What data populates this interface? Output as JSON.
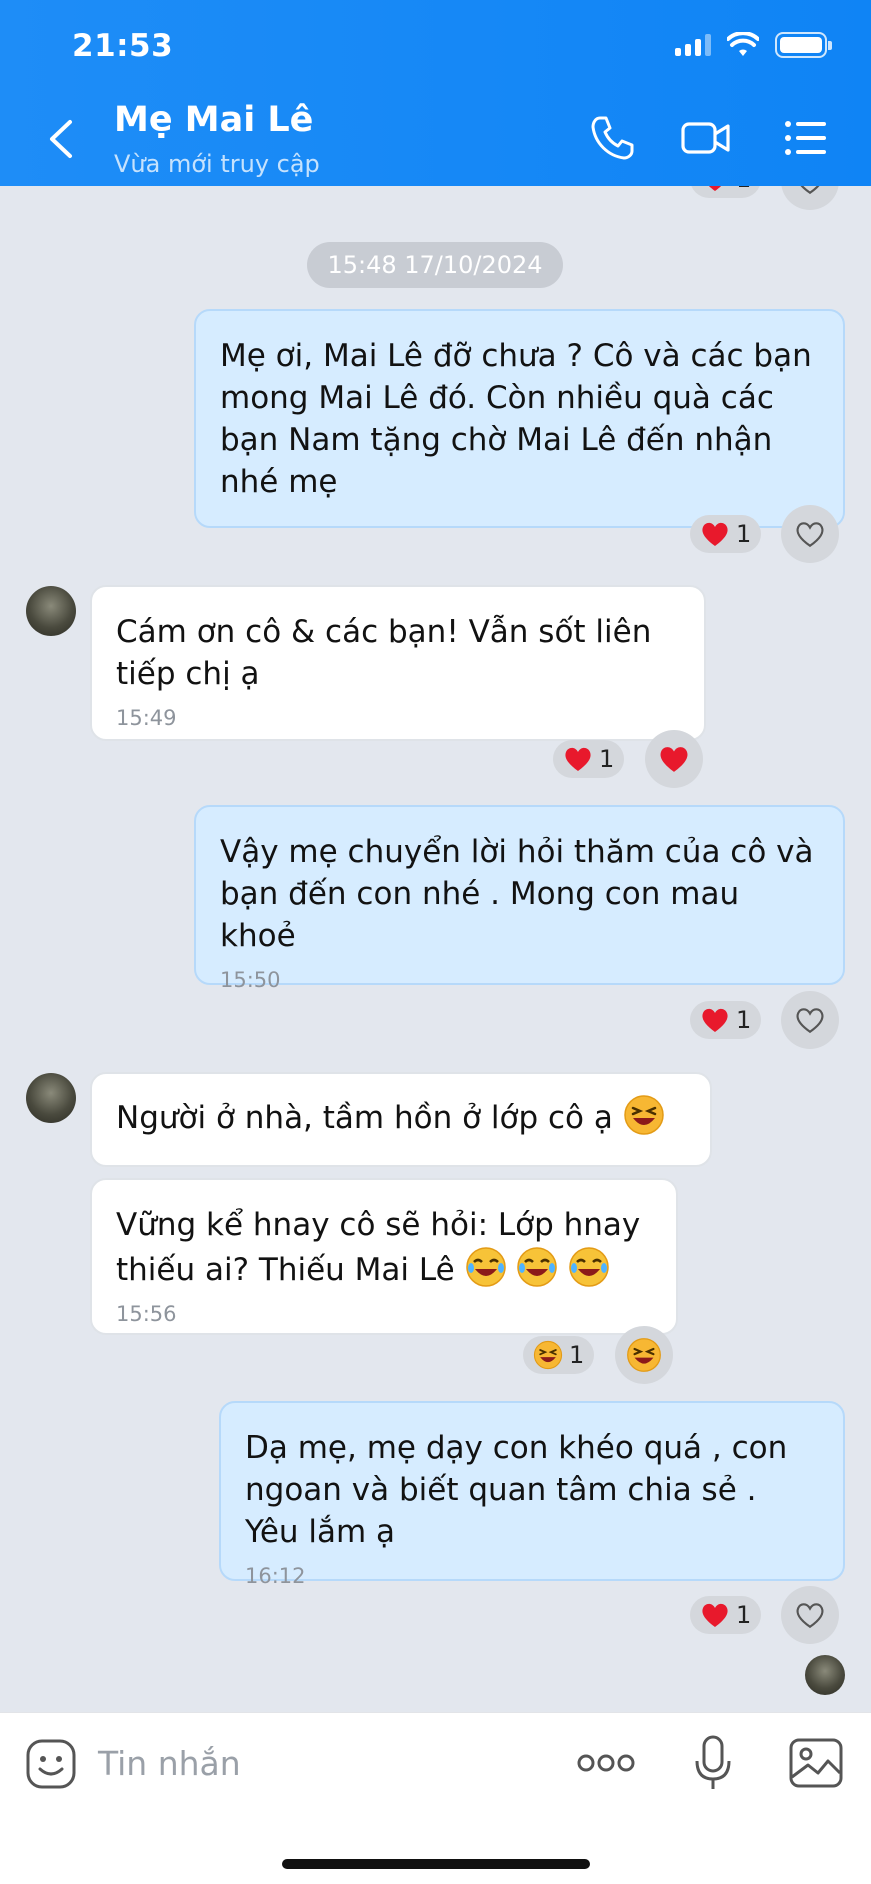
{
  "status_bar": {
    "time": "21:53"
  },
  "header": {
    "title": "Mẹ Mai Lê",
    "subtitle": "Vừa mới truy cập"
  },
  "chat": {
    "top_reaction_count": "1",
    "date_separator": "15:48 17/10/2024",
    "messages": [
      {
        "side": "out",
        "text": "Mẹ ơi, Mai Lê đỡ chưa ? Cô và các bạn mong Mai Lê đó. Còn nhiều quà các bạn Nam tặng chờ Mai Lê đến nhận nhé mẹ",
        "time": "",
        "reaction_emoji": "heart",
        "reaction_count": "1"
      },
      {
        "side": "in",
        "text": "Cám ơn cô & các bạn! Vẫn sốt liên tiếp chị ạ",
        "time": "15:49",
        "reaction_emoji": "heart",
        "reaction_count": "1"
      },
      {
        "side": "out",
        "text": "Vậy mẹ chuyển lời hỏi thăm của cô và bạn đến con nhé . Mong con mau khoẻ",
        "time": "15:50",
        "reaction_emoji": "heart",
        "reaction_count": "1"
      },
      {
        "side": "in",
        "text": "Người ở nhà, tầm hồn ở lớp cô ạ",
        "time": "",
        "emoji_suffix": "grinning-squint"
      },
      {
        "side": "in",
        "text_line1": "Vững kể hnay cô sẽ hỏi: Lớp hnay",
        "text_line2": "thiếu ai? Thiếu Mai Lê",
        "time": "15:56",
        "emoji_suffix": "tears-of-joy x3",
        "reaction_emoji": "grinning-squint",
        "reaction_count": "1"
      },
      {
        "side": "out",
        "text": "Dạ mẹ, mẹ dạy con khéo quá , con ngoan và biết quan tâm chia sẻ . Yêu lắm ạ",
        "time": "16:12",
        "reaction_emoji": "heart",
        "reaction_count": "1"
      }
    ]
  },
  "input_bar": {
    "placeholder": "Tin nhắn"
  },
  "colors": {
    "header": "#1e8df7",
    "outgoing_bubble": "#d6ecff",
    "incoming_bubble": "#ffffff",
    "background": "#e3e7ee",
    "heart": "#e8192c"
  }
}
